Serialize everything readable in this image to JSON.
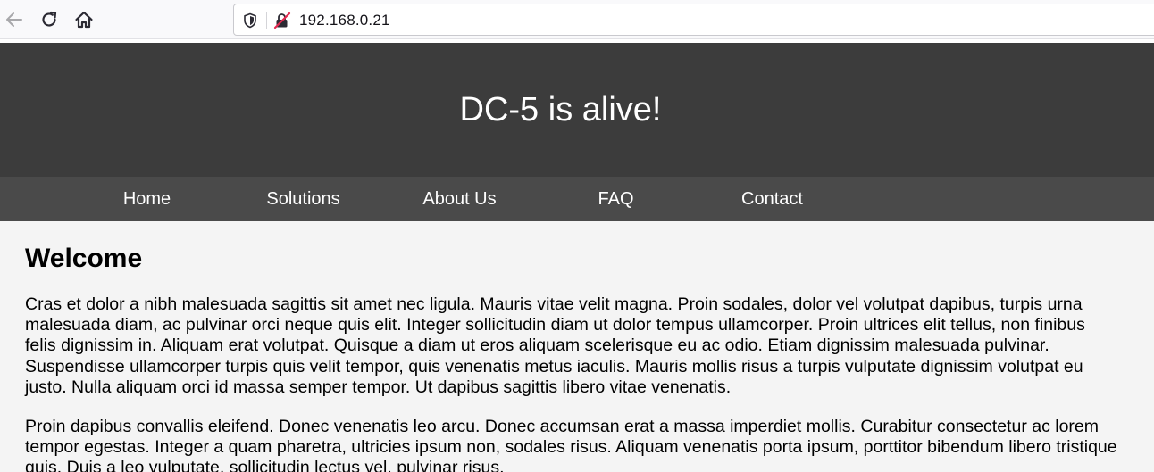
{
  "browser": {
    "url": "192.168.0.21",
    "icons": {
      "back": "arrow-left-icon",
      "reload": "reload-icon",
      "home": "home-icon",
      "tracking": "shield-icon",
      "insecure": "insecure-lock-icon"
    }
  },
  "site": {
    "title": "DC-5 is alive!",
    "nav": [
      {
        "label": "Home"
      },
      {
        "label": "Solutions"
      },
      {
        "label": "About Us"
      },
      {
        "label": "FAQ"
      },
      {
        "label": "Contact"
      }
    ]
  },
  "content": {
    "heading": "Welcome",
    "paragraphs": [
      "Cras et dolor a nibh malesuada sagittis sit amet nec ligula. Mauris vitae velit magna. Proin sodales, dolor vel volutpat dapibus, turpis urna malesuada diam, ac pulvinar orci neque quis elit. Integer sollicitudin diam ut dolor tempus ullamcorper. Proin ultrices elit tellus, non finibus felis dignissim in. Aliquam erat volutpat. Quisque a diam ut eros aliquam scelerisque eu ac odio. Etiam dignissim malesuada pulvinar. Suspendisse ullamcorper turpis quis velit tempor, quis venenatis metus iaculis. Mauris mollis risus a turpis vulputate dignissim volutpat eu justo. Nulla aliquam orci id massa semper tempor. Ut dapibus sagittis libero vitae venenatis.",
      "Proin dapibus convallis eleifend. Donec venenatis leo arcu. Donec accumsan erat a massa imperdiet mollis. Curabitur consectetur ac lorem tempor egestas. Integer a quam pharetra, ultricies ipsum non, sodales risus. Aliquam venenatis porta ipsum, porttitor bibendum libero tristique quis. Duis a leo vulputate, sollicitudin lectus vel, pulvinar risus."
    ]
  },
  "colors": {
    "header_bg": "#3c3c3c",
    "nav_bg": "#4a4a4a",
    "page_bg": "#f4f4f4"
  }
}
